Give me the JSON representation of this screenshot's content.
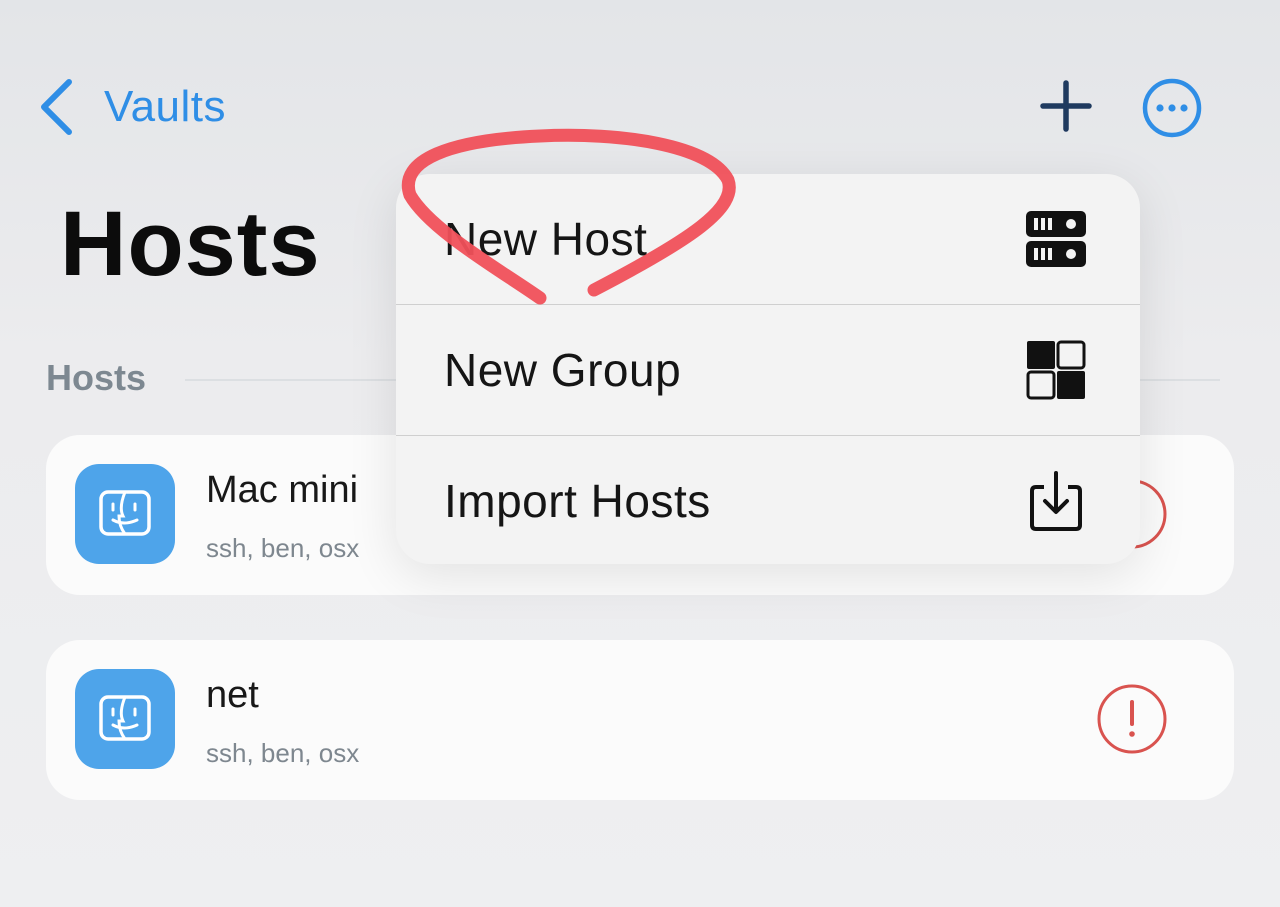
{
  "nav": {
    "back_label": "Vaults",
    "back_icon": "chevron-left-icon",
    "add_icon": "plus-icon",
    "more_icon": "ellipsis-circle-icon",
    "accent": "#2f8ee6"
  },
  "page": {
    "title": "Hosts",
    "section_header": "Hosts"
  },
  "hosts": [
    {
      "name": "Mac mini",
      "tags": "ssh, ben, osx",
      "icon": "finder-icon",
      "status_icon": "warning-icon"
    },
    {
      "name": "net",
      "tags": "ssh, ben, osx",
      "icon": "finder-icon",
      "status_icon": "warning-icon"
    }
  ],
  "menu": {
    "items": [
      {
        "label": "New Host",
        "icon": "server-icon"
      },
      {
        "label": "New Group",
        "icon": "group-icon"
      },
      {
        "label": "Import Hosts",
        "icon": "import-icon"
      }
    ]
  },
  "colors": {
    "host_icon_bg": "#4ea4ea",
    "warning": "#d9534f",
    "annotation": "#f0505a"
  }
}
